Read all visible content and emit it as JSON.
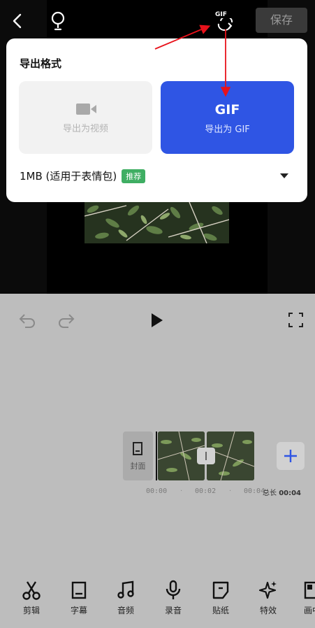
{
  "topbar": {
    "save_label": "保存",
    "gif_switch_text": "GIF"
  },
  "export_panel": {
    "title": "导出格式",
    "video_option_label": "导出为视频",
    "gif_option_title": "GIF",
    "gif_option_label": "导出为 GIF",
    "size_label": "1MB (适用于表情包)",
    "recommend_tag": "推荐",
    "selected": "gif"
  },
  "timeline": {
    "cover_label": "封面",
    "times": [
      "00:00",
      "00:02",
      "00:04"
    ],
    "total_label": "总长",
    "total_value": "00:04"
  },
  "toolbar": [
    {
      "label": "剪辑",
      "icon": "scissors-icon"
    },
    {
      "label": "字幕",
      "icon": "subtitle-icon"
    },
    {
      "label": "音频",
      "icon": "music-icon"
    },
    {
      "label": "录音",
      "icon": "microphone-icon"
    },
    {
      "label": "贴纸",
      "icon": "sticker-icon"
    },
    {
      "label": "特效",
      "icon": "sparkle-icon"
    },
    {
      "label": "画中",
      "icon": "picture-in-picture-icon"
    }
  ],
  "colors": {
    "accent": "#2f55e4",
    "tag_green": "#3fae63",
    "annotation_red": "#e8121b"
  }
}
